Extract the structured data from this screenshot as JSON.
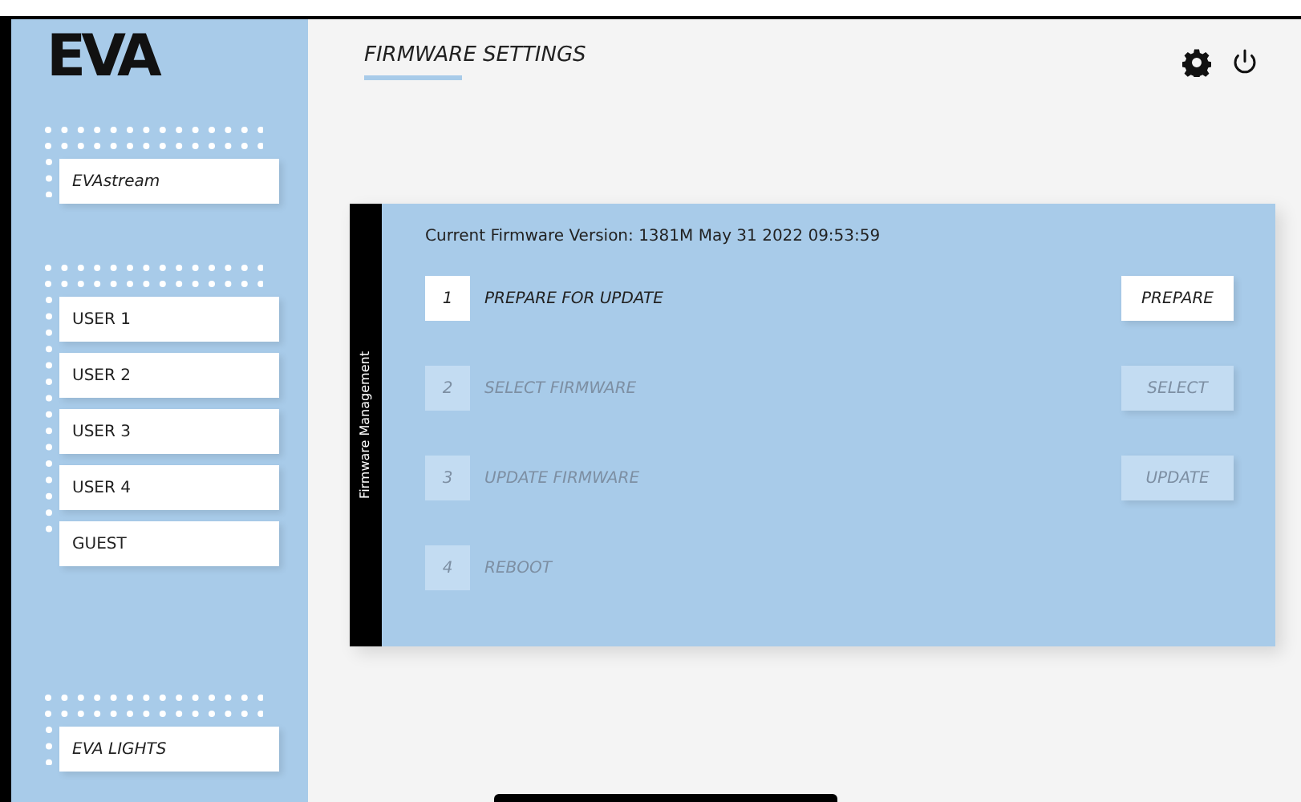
{
  "logo": "EVA",
  "sidebar": {
    "groups": [
      {
        "kind": "app",
        "items": [
          {
            "label": "EVAstream"
          }
        ]
      },
      {
        "kind": "users",
        "items": [
          {
            "label": "USER 1"
          },
          {
            "label": "USER 2"
          },
          {
            "label": "USER 3"
          },
          {
            "label": "USER 4"
          },
          {
            "label": "GUEST"
          }
        ]
      },
      {
        "kind": "app",
        "items": [
          {
            "label": "EVA LIGHTS"
          }
        ]
      }
    ]
  },
  "header": {
    "title": "FIRMWARE SETTINGS"
  },
  "panel": {
    "side_label": "Firmware Management",
    "version": "Current Firmware Version: 1381M May 31 2022 09:53:59",
    "steps": [
      {
        "number": "1",
        "label": "PREPARE FOR UPDATE",
        "enabled": true,
        "button": "PREPARE"
      },
      {
        "number": "2",
        "label": "SELECT FIRMWARE",
        "enabled": false,
        "button": "SELECT"
      },
      {
        "number": "3",
        "label": "UPDATE FIRMWARE",
        "enabled": false,
        "button": "UPDATE"
      },
      {
        "number": "4",
        "label": "REBOOT",
        "enabled": false
      }
    ]
  }
}
